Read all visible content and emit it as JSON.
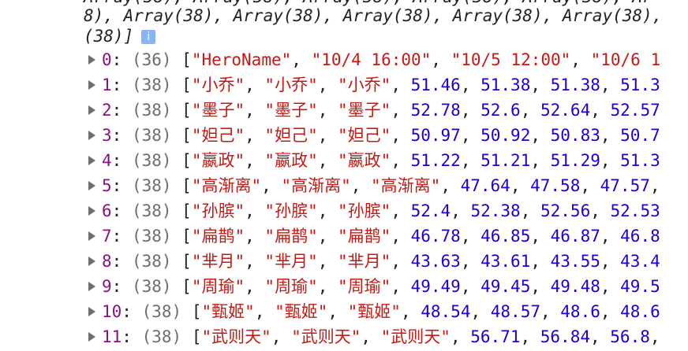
{
  "summary": {
    "line1": "Array(38), Array(38), Array(38), Array(38), Array(38), Ar",
    "line2": "8), Array(38), Array(38), Array(38), Array(38), Array(38),",
    "line3": "(38)]",
    "info_icon": "i"
  },
  "rows": [
    {
      "index": "0",
      "count": "(36)",
      "strings": [
        "\"HeroName\"",
        "\"10/4 16:00\"",
        "\"10/5 12:00\"",
        "\"10/6 1"
      ],
      "numbers": []
    },
    {
      "index": "1",
      "count": "(38)",
      "strings": [
        "\"小乔\"",
        "\"小乔\"",
        "\"小乔\""
      ],
      "numbers": [
        "51.46",
        "51.38",
        "51.38",
        "51.3"
      ]
    },
    {
      "index": "2",
      "count": "(38)",
      "strings": [
        "\"墨子\"",
        "\"墨子\"",
        "\"墨子\""
      ],
      "numbers": [
        "52.78",
        "52.6",
        "52.64",
        "52.57"
      ]
    },
    {
      "index": "3",
      "count": "(38)",
      "strings": [
        "\"妲己\"",
        "\"妲己\"",
        "\"妲己\""
      ],
      "numbers": [
        "50.97",
        "50.92",
        "50.83",
        "50.7"
      ]
    },
    {
      "index": "4",
      "count": "(38)",
      "strings": [
        "\"嬴政\"",
        "\"嬴政\"",
        "\"嬴政\""
      ],
      "numbers": [
        "51.22",
        "51.21",
        "51.29",
        "51.3"
      ]
    },
    {
      "index": "5",
      "count": "(38)",
      "strings": [
        "\"高渐离\"",
        "\"高渐离\"",
        "\"高渐离\""
      ],
      "numbers": [
        "47.64",
        "47.58",
        "47.57"
      ]
    },
    {
      "index": "6",
      "count": "(38)",
      "strings": [
        "\"孙膑\"",
        "\"孙膑\"",
        "\"孙膑\""
      ],
      "numbers": [
        "52.4",
        "52.38",
        "52.56",
        "52.53"
      ]
    },
    {
      "index": "7",
      "count": "(38)",
      "strings": [
        "\"扁鹊\"",
        "\"扁鹊\"",
        "\"扁鹊\""
      ],
      "numbers": [
        "46.78",
        "46.85",
        "46.87",
        "46.8"
      ]
    },
    {
      "index": "8",
      "count": "(38)",
      "strings": [
        "\"芈月\"",
        "\"芈月\"",
        "\"芈月\""
      ],
      "numbers": [
        "43.63",
        "43.61",
        "43.55",
        "43.4"
      ]
    },
    {
      "index": "9",
      "count": "(38)",
      "strings": [
        "\"周瑜\"",
        "\"周瑜\"",
        "\"周瑜\""
      ],
      "numbers": [
        "49.49",
        "49.45",
        "49.48",
        "49.5"
      ]
    },
    {
      "index": "10",
      "count": "(38)",
      "strings": [
        "\"甄姬\"",
        "\"甄姬\"",
        "\"甄姬\""
      ],
      "numbers": [
        "48.54",
        "48.57",
        "48.6",
        "48.6"
      ]
    },
    {
      "index": "11",
      "count": "(38)",
      "strings": [
        "\"武则天\"",
        "\"武则天\"",
        "\"武则天\""
      ],
      "numbers": [
        "56.71",
        "56.84",
        "56.8"
      ]
    }
  ],
  "colors": {
    "index": "#881280",
    "string": "#c41a16",
    "number": "#1c00cf",
    "count": "#6e6e6e",
    "info_icon_bg": "#8ab4f8"
  }
}
